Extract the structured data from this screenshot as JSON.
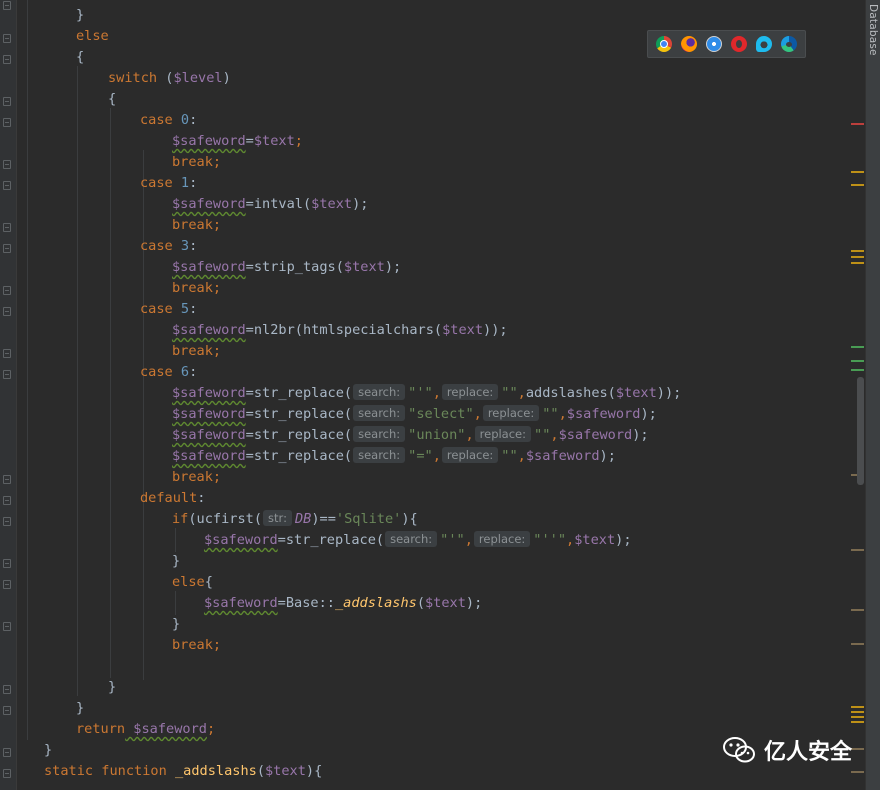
{
  "side_panel": {
    "label": "Database"
  },
  "browser_icons": [
    {
      "name": "chrome-icon"
    },
    {
      "name": "firefox-icon"
    },
    {
      "name": "safari-icon"
    },
    {
      "name": "opera-icon"
    },
    {
      "name": "ie-icon"
    },
    {
      "name": "edge-icon"
    }
  ],
  "watermark": {
    "text": "亿人安全"
  },
  "hints": {
    "search": "search:",
    "replace": "replace:",
    "str": "str:"
  },
  "code": {
    "l0": {
      "close": "}"
    },
    "l1": {
      "else": "else"
    },
    "l2": {
      "open": "{"
    },
    "l3": {
      "switch": "switch",
      "paren_open": " (",
      "var": "$level",
      "paren_close": ")"
    },
    "l4": {
      "open": "{"
    },
    "l5": {
      "case": "case",
      "num": " 0",
      "colon": ":"
    },
    "l6": {
      "var": "$safeword",
      "eq": "=",
      "arg": "$text",
      "semi": ";"
    },
    "l7": {
      "break": "break",
      "semi": ";"
    },
    "l8": {
      "case": "case",
      "num": " 1",
      "colon": ":"
    },
    "l9": {
      "var": "$safeword",
      "eq": "=",
      "fn": "intval(",
      "arg": "$text",
      "end": ");"
    },
    "l10": {
      "break": "break",
      "semi": ";"
    },
    "l11": {
      "case": "case",
      "num": " 3",
      "colon": ":"
    },
    "l12": {
      "var": "$safeword",
      "eq": "=",
      "fn": "strip_tags(",
      "arg": "$text",
      "end": ");"
    },
    "l13": {
      "break": "break",
      "semi": ";"
    },
    "l14": {
      "case": "case",
      "num": " 5",
      "colon": ":"
    },
    "l15": {
      "var": "$safeword",
      "eq": "=",
      "fn": "nl2br(htmlspecialchars(",
      "arg": "$text",
      "end": "));"
    },
    "l16": {
      "break": "break",
      "semi": ";"
    },
    "l17": {
      "case": "case",
      "num": " 6",
      "colon": ":"
    },
    "l18": {
      "var": "$safeword",
      "eq": "=",
      "fn": "str_replace(",
      "s1": "\"'\"",
      "comma1": ",",
      "s2": "\"\"",
      "comma2": ",",
      "fn2": "addslashes(",
      "arg": "$text",
      "end": "));"
    },
    "l19": {
      "var": "$safeword",
      "eq": "=",
      "fn": "str_replace(",
      "s1": "\"select\"",
      "comma1": ",",
      "s2": "\"\"",
      "comma2": ",",
      "arg": "$safeword",
      "end": ");"
    },
    "l20": {
      "var": "$safeword",
      "eq": "=",
      "fn": "str_replace(",
      "s1": "\"union\"",
      "comma1": ",",
      "s2": "\"\"",
      "comma2": ",",
      "arg": "$safeword",
      "end": ");"
    },
    "l21": {
      "var": "$safeword",
      "eq": "=",
      "fn": "str_replace(",
      "s1": "\"=\"",
      "comma1": ",",
      "s2": "\"\"",
      "comma2": ",",
      "arg": "$safeword",
      "end": ");"
    },
    "l22": {
      "break": "break",
      "semi": ";"
    },
    "l23": {
      "default": "default",
      "colon": ":"
    },
    "l24": {
      "if": "if",
      "fn": "(ucfirst(",
      "const": "DB",
      "mid": ")==",
      "str": "'Sqlite'",
      "end": "){"
    },
    "l25": {
      "var": "$safeword",
      "eq": "=",
      "fn": "str_replace(",
      "s1": "\"'\"",
      "comma1": ",",
      "s2": "\"''\"",
      "comma2": ",",
      "arg": "$text",
      "end": ");"
    },
    "l26": {
      "close": "}"
    },
    "l27": {
      "else": "else",
      "open": "{"
    },
    "l28": {
      "var": "$safeword",
      "eq": "=",
      "cls": "Base::",
      "method": "_addslashs",
      "po": "(",
      "arg": "$text",
      "end": ");"
    },
    "l29": {
      "close": "}"
    },
    "l30": {
      "break": "break",
      "semi": ";"
    },
    "l32": {
      "close": "}"
    },
    "l33": {
      "close": "}"
    },
    "l34": {
      "return": "return",
      "var": " $safeword",
      "semi": ";"
    },
    "l35": {
      "close": "}"
    },
    "l36": {
      "static": "static",
      "function": " function",
      "name": " _addslashs",
      "po": "(",
      "arg": "$text",
      "end": "){"
    }
  }
}
